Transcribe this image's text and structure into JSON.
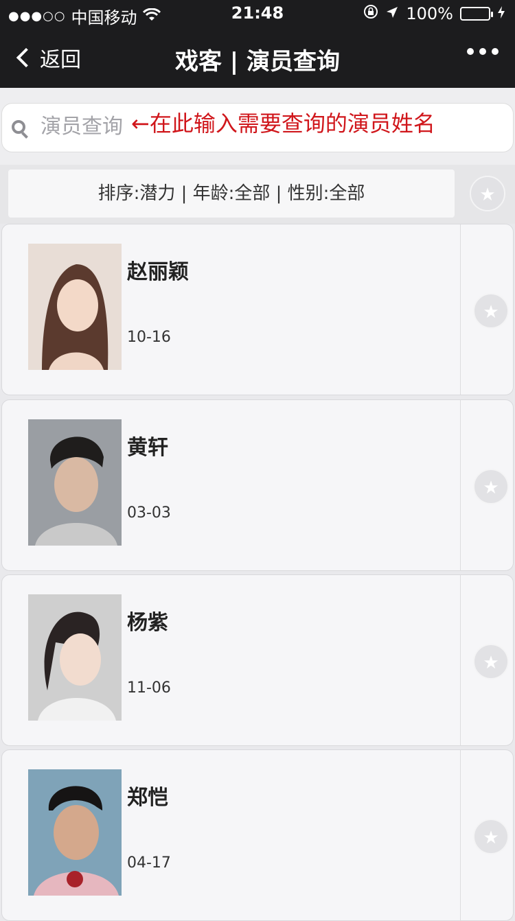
{
  "status_bar": {
    "carrier": "中国移动",
    "signal": "●●●○○",
    "time": "21:48",
    "battery": "100%",
    "battery_level": 1.0
  },
  "nav": {
    "back_label": "返回",
    "title": "戏客 | 演员查询",
    "more_icon": "more-dots-icon"
  },
  "search": {
    "placeholder": "演员查询",
    "annotation": "←在此输入需要查询的演员姓名"
  },
  "filter": {
    "label": "排序:潜力 | 年龄:全部 | 性别:全部"
  },
  "actors": [
    {
      "name": "赵丽颖",
      "date": "10-16"
    },
    {
      "name": "黄轩",
      "date": "03-03"
    },
    {
      "name": "杨紫",
      "date": "11-06"
    },
    {
      "name": "郑恺",
      "date": "04-17"
    }
  ],
  "colors": {
    "nav_bg": "#1c1c1e",
    "annotation": "#d0161b",
    "battery": "#4cd964"
  }
}
